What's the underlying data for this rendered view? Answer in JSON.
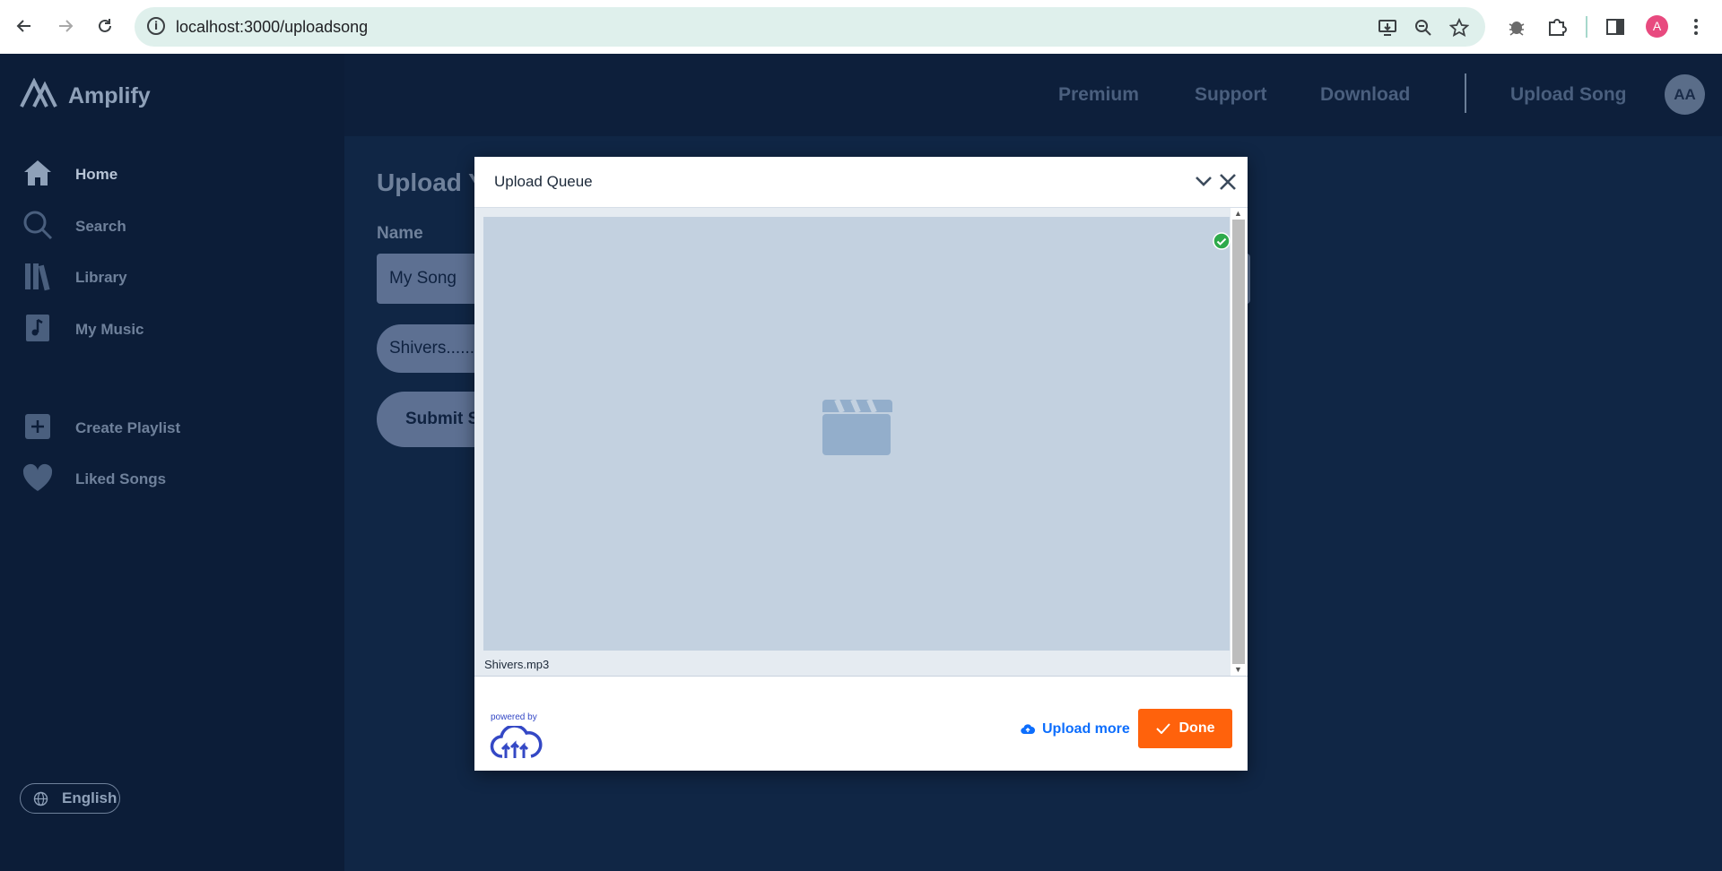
{
  "browser": {
    "url": "localhost:3000/uploadsong",
    "profile_initial": "A"
  },
  "app": {
    "brand": "Amplify",
    "sidebar": {
      "items": [
        {
          "label": "Home",
          "icon": "home-icon"
        },
        {
          "label": "Search",
          "icon": "search-icon"
        },
        {
          "label": "Library",
          "icon": "library-icon"
        },
        {
          "label": "My Music",
          "icon": "music-note-icon"
        },
        {
          "label": "Create Playlist",
          "icon": "plus-square-icon"
        },
        {
          "label": "Liked Songs",
          "icon": "heart-icon"
        }
      ],
      "language": "English"
    },
    "topnav": {
      "premium": "Premium",
      "support": "Support",
      "download": "Download",
      "upload_song": "Upload Song",
      "avatar": "AA"
    },
    "form": {
      "title": "Upload Y",
      "name_label": "Name",
      "name_value": "My Song",
      "file_value": "Shivers......",
      "submit_label": "Submit S"
    }
  },
  "modal": {
    "title": "Upload Queue",
    "file_name": "Shivers.mp3",
    "powered_by": "powered by",
    "upload_more": "Upload more",
    "done": "Done",
    "colors": {
      "done": "#ff620c",
      "link": "#0d6efd",
      "success": "#2eaa4b"
    }
  }
}
